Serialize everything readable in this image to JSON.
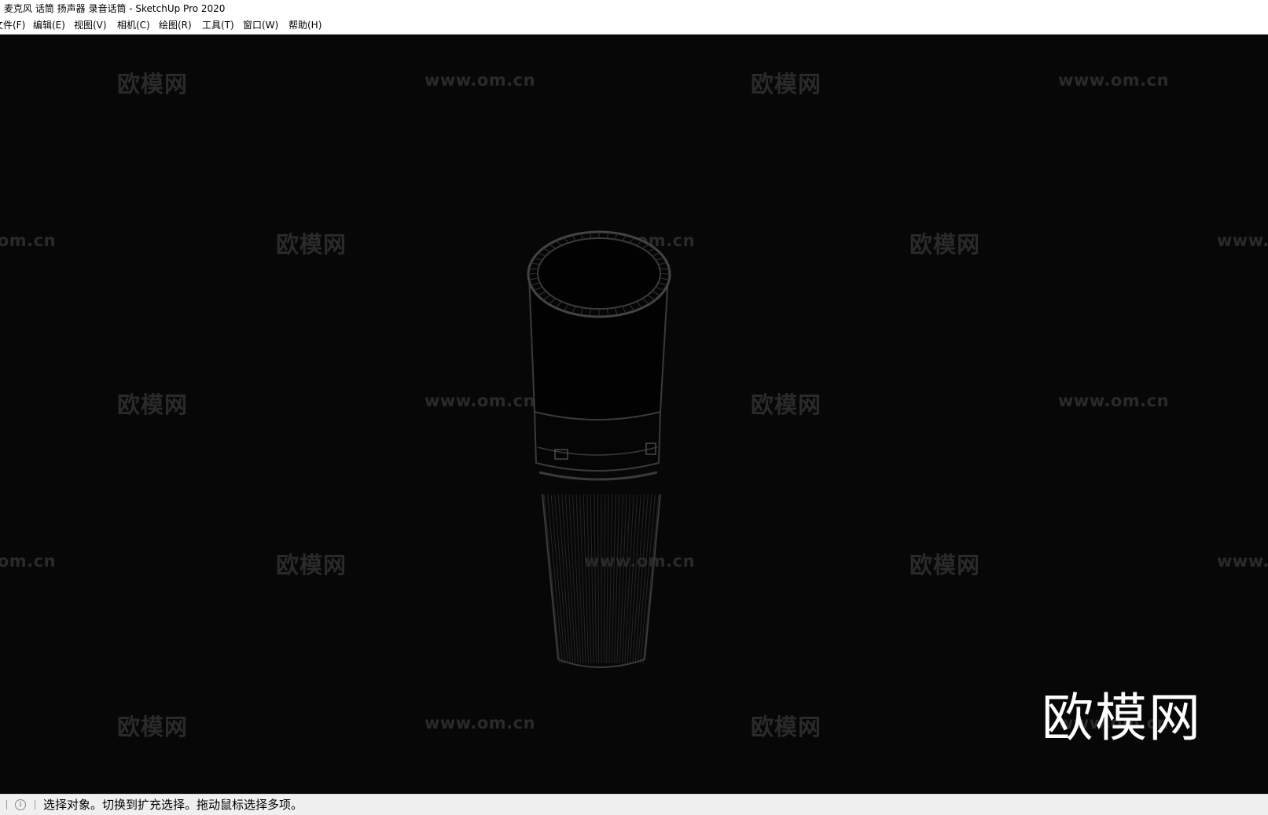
{
  "window": {
    "title": "麦克风 话筒 扬声器 录音话筒 - SketchUp Pro 2020"
  },
  "menu": {
    "items": [
      {
        "label": "文件(F)"
      },
      {
        "label": "编辑(E)"
      },
      {
        "label": "视图(V)"
      },
      {
        "label": "相机(C)"
      },
      {
        "label": "绘图(R)"
      },
      {
        "label": "工具(T)"
      },
      {
        "label": "窗口(W)"
      },
      {
        "label": "帮助(H)"
      }
    ]
  },
  "watermark": {
    "brand_cn": "欧模网",
    "url": "www.om.cn"
  },
  "status": {
    "info_icon": "info-icon",
    "text": "选择对象。切换到扩充选择。拖动鼠标选择多项。"
  },
  "colors": {
    "viewport_bg": "#070707",
    "model_edge": "#3a3a3a",
    "watermark": "#2a2a2a",
    "logo": "#ffffff"
  }
}
